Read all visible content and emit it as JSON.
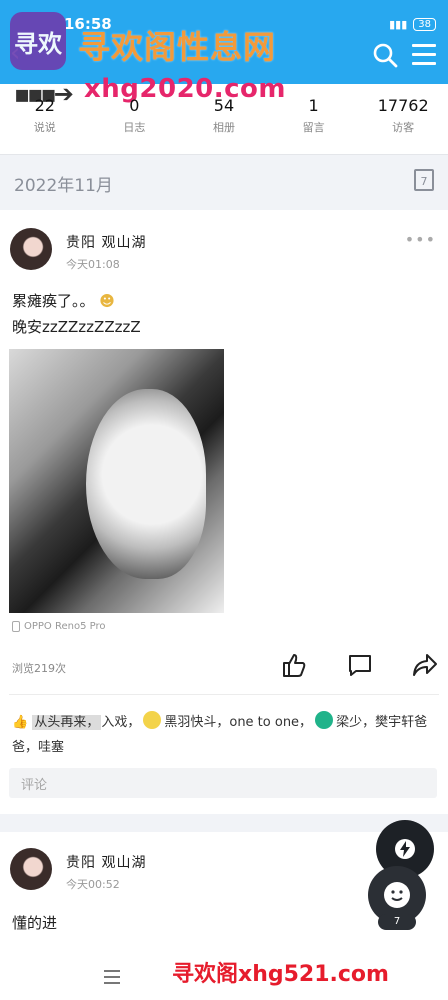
{
  "status": {
    "time": "16:58",
    "battery": "38"
  },
  "header": {
    "logo_text": "寻欢",
    "site_name": "寻欢阁性息网",
    "url_banner": "xhg2020.com"
  },
  "stats": [
    {
      "num": "22",
      "label": "说说"
    },
    {
      "num": "0",
      "label": "日志"
    },
    {
      "num": "54",
      "label": "相册"
    },
    {
      "num": "1",
      "label": "留言"
    },
    {
      "num": "17762",
      "label": "访客"
    }
  ],
  "month": {
    "label": "2022年11月",
    "calendar_day": "7"
  },
  "post1": {
    "author": "贵阳 观山湖",
    "time": "今天01:08",
    "line1": "累瘫痪了。。",
    "line2": "晚安zzZZzzZZzzZ",
    "device": "OPPO Reno5 Pro",
    "views": "浏览219次",
    "likes_highlight": "从头再来，",
    "likes_part2": "入戏，",
    "likes_part3": "黑羽快斗，one to one，",
    "likes_part4": "梁少，樊宇轩爸爸，哇塞",
    "comment_placeholder": "评论"
  },
  "post2": {
    "author": "贵阳 观山湖",
    "time": "今天00:52",
    "text": "懂的进"
  },
  "fab": {
    "count": "7"
  },
  "footer": {
    "watermark": "寻欢阁xhg521.com"
  },
  "icons": [
    "back-icon",
    "search-icon",
    "menu-icon",
    "calendar-icon",
    "more-icon",
    "like-icon",
    "comment-icon",
    "share-icon",
    "lightning-icon",
    "smiley-icon",
    "phone-icon"
  ]
}
